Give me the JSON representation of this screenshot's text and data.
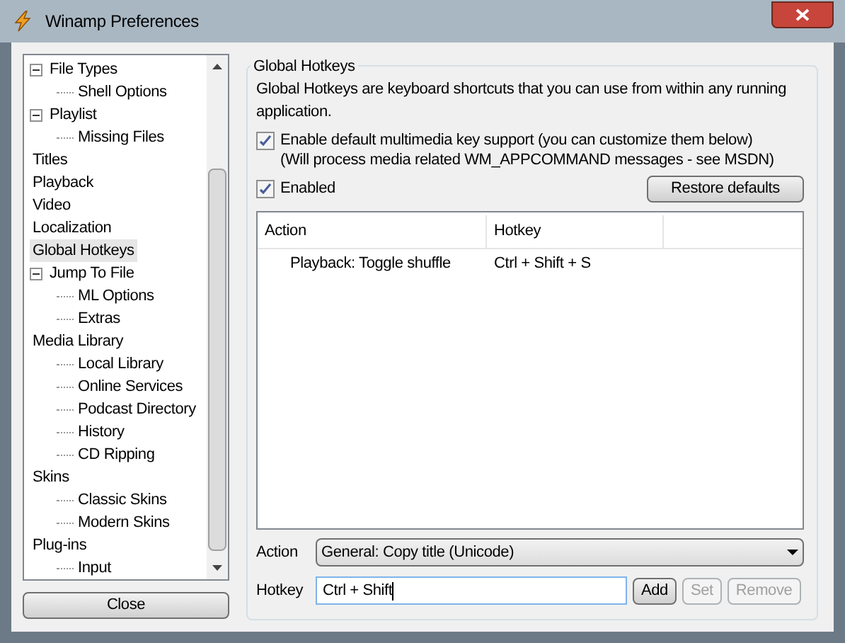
{
  "window": {
    "title": "Winamp Preferences"
  },
  "tree": {
    "items": [
      {
        "children": [
          {
            "label": "File Types",
            "selected": false,
            "expanded": true,
            "children": [
              {
                "label": "Shell Options",
                "selected": false
              }
            ]
          },
          {
            "label": "Playlist",
            "selected": false,
            "expanded": true,
            "children": [
              {
                "label": "Missing Files",
                "selected": false
              }
            ]
          },
          {
            "label": "Titles",
            "selected": false
          },
          {
            "label": "Playback",
            "selected": false
          },
          {
            "label": "Video",
            "selected": false
          },
          {
            "label": "Localization",
            "selected": false
          },
          {
            "label": "Global Hotkeys",
            "selected": true
          },
          {
            "label": "Jump To File",
            "selected": false,
            "expanded": true,
            "children": [
              {
                "label": "ML Options",
                "selected": false
              },
              {
                "label": "Extras",
                "selected": false
              }
            ]
          }
        ]
      },
      {
        "label": "Media Library",
        "selected": false,
        "children": [
          {
            "label": "Local Library",
            "selected": false
          },
          {
            "label": "Online Services",
            "selected": false
          },
          {
            "label": "Podcast Directory",
            "selected": false
          },
          {
            "label": "History",
            "selected": false
          },
          {
            "label": "CD Ripping",
            "selected": false
          }
        ]
      },
      {
        "label": "Skins",
        "selected": false,
        "children": [
          {
            "label": "Classic Skins",
            "selected": false
          },
          {
            "label": "Modern Skins",
            "selected": false
          }
        ]
      },
      {
        "label": "Plug-ins",
        "selected": false,
        "children": [
          {
            "label": "Input",
            "selected": false
          }
        ]
      }
    ]
  },
  "close_button": "Close",
  "group": {
    "title": "Global Hotkeys",
    "description": "Global Hotkeys are keyboard shortcuts that you can use from within any running application.",
    "checkboxes": [
      {
        "label": "Enable default multimedia key support (you can customize them below)",
        "note": "(Will process media related WM_APPCOMMAND messages - see MSDN)",
        "checked": true
      },
      {
        "label": "Enabled",
        "checked": true
      }
    ],
    "restore_button": "Restore defaults",
    "table": {
      "columns": [
        "Action",
        "Hotkey"
      ],
      "rows": [
        {
          "action": "Playback: Toggle shuffle",
          "hotkey": "Ctrl + Shift + S"
        }
      ]
    },
    "action_label": "Action",
    "action_value": "General: Copy title (Unicode)",
    "hotkey_label": "Hotkey",
    "hotkey_value": "Ctrl + Shift",
    "buttons": [
      {
        "label": "Add",
        "disabled": false
      },
      {
        "label": "Set",
        "disabled": true
      },
      {
        "label": "Remove",
        "disabled": true
      }
    ]
  }
}
